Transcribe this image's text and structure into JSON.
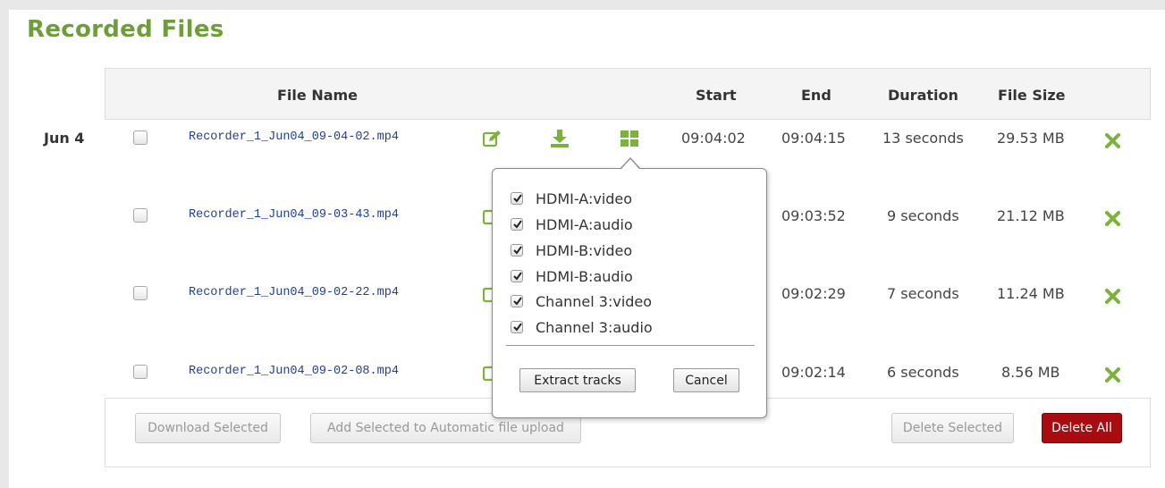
{
  "page": {
    "title": "Recorded Files"
  },
  "table": {
    "headers": {
      "file_name": "File Name",
      "start": "Start",
      "end": "End",
      "duration": "Duration",
      "file_size": "File Size"
    },
    "date_group": "Jun 4",
    "rows": [
      {
        "file_name": "Recorder_1_Jun04_09-04-02.mp4",
        "start": "09:04:02",
        "end": "09:04:15",
        "duration": "13 seconds",
        "size": "29.53 MB"
      },
      {
        "file_name": "Recorder_1_Jun04_09-03-43.mp4",
        "start": "",
        "end": "09:03:52",
        "duration": "9 seconds",
        "size": "21.12 MB"
      },
      {
        "file_name": "Recorder_1_Jun04_09-02-22.mp4",
        "start": "",
        "end": "09:02:29",
        "duration": "7 seconds",
        "size": "11.24 MB"
      },
      {
        "file_name": "Recorder_1_Jun04_09-02-08.mp4",
        "start": "",
        "end": "09:02:14",
        "duration": "6 seconds",
        "size": "8.56 MB"
      }
    ]
  },
  "footer": {
    "download_selected": "Download Selected",
    "add_to_upload": "Add Selected to Automatic file upload",
    "delete_selected": "Delete Selected",
    "delete_all": "Delete All"
  },
  "popup": {
    "tracks": [
      {
        "label": "HDMI-A:video",
        "checked": true
      },
      {
        "label": "HDMI-A:audio",
        "checked": true
      },
      {
        "label": "HDMI-B:video",
        "checked": true
      },
      {
        "label": "HDMI-B:audio",
        "checked": true
      },
      {
        "label": "Channel 3:video",
        "checked": true
      },
      {
        "label": "Channel 3:audio",
        "checked": true
      }
    ],
    "extract_label": "Extract tracks",
    "cancel_label": "Cancel"
  },
  "colors": {
    "brand_green": "#6d9e3a",
    "icon_green": "#79b33a",
    "link_blue": "#1f3fa0",
    "danger_red": "#a80c10"
  },
  "icons": {
    "edit": "edit-icon",
    "download": "download-icon",
    "extract": "grid-icon",
    "delete": "close-icon"
  }
}
